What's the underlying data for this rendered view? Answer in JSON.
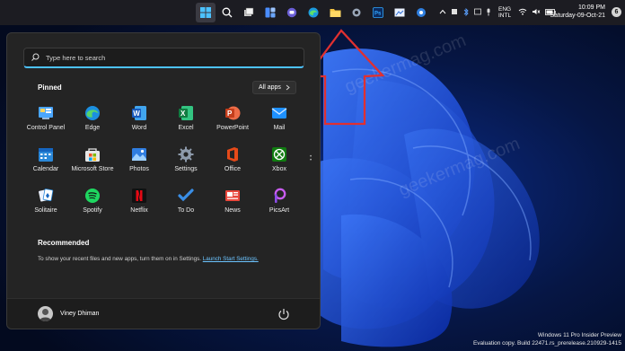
{
  "taskbar": {
    "tray": {
      "lang_line1": "ENG",
      "lang_line2": "INTL"
    },
    "clock": {
      "time": "10:09 PM",
      "date": "Saturday-09-Oct-21"
    },
    "notification_count": "6"
  },
  "start": {
    "search": {
      "placeholder": "Type here to search"
    },
    "pinned_title": "Pinned",
    "all_apps_label": "All apps",
    "apps": [
      {
        "label": "Control Panel"
      },
      {
        "label": "Edge"
      },
      {
        "label": "Word"
      },
      {
        "label": "Excel"
      },
      {
        "label": "PowerPoint"
      },
      {
        "label": "Mail"
      },
      {
        "label": "Calendar"
      },
      {
        "label": "Microsoft Store"
      },
      {
        "label": "Photos"
      },
      {
        "label": "Settings"
      },
      {
        "label": "Office"
      },
      {
        "label": "Xbox"
      },
      {
        "label": "Solitaire"
      },
      {
        "label": "Spotify"
      },
      {
        "label": "Netflix"
      },
      {
        "label": "To Do"
      },
      {
        "label": "News"
      },
      {
        "label": "PicsArt"
      }
    ],
    "recommended_title": "Recommended",
    "recommended_text": "To show your recent files and new apps, turn them on in Settings.",
    "recommended_link": "Launch Start Settings.",
    "user_name": "Viney Dhiman"
  },
  "desktop": {
    "eval_line1": "Windows 11 Pro Insider Preview",
    "eval_line2": "Evaluation copy. Build 22471.rs_prerelease.210929-1415",
    "watermark": "geekermag.com"
  },
  "colors": {
    "accent": "#4cc2ff",
    "arrow": "#e03030",
    "taskbar": "#1c1c22",
    "panel": "#242424"
  }
}
